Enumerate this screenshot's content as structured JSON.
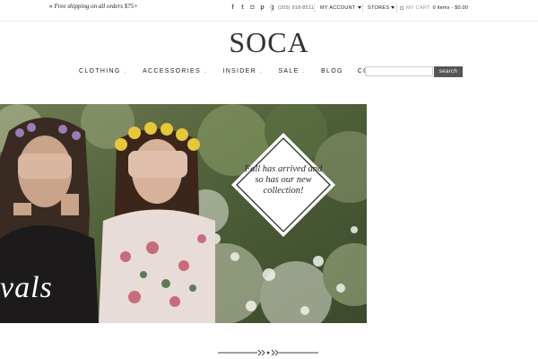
{
  "topbar": {
    "promo_arrows": "»",
    "promo_text": "Free shipping on all orders $75+",
    "social_icons": [
      "facebook-icon",
      "twitter-icon",
      "instagram-icon",
      "pinterest-icon",
      "googleplus-icon"
    ],
    "social_glyphs": [
      "f",
      "t",
      "◘",
      "p",
      "g"
    ],
    "phone": "(205) 918-8511",
    "my_account": "MY ACCOUNT",
    "stores": "STORES",
    "cart_label": "MY CART",
    "cart_summary": "0 items - $0.00"
  },
  "logo": "SOCA",
  "nav": {
    "items": [
      {
        "label": "CLOTHING",
        "dropdown": true
      },
      {
        "label": "ACCESSORIES",
        "dropdown": true
      },
      {
        "label": "INSIDER",
        "dropdown": true
      },
      {
        "label": "SALE",
        "dropdown": true
      },
      {
        "label": "BLOG",
        "dropdown": false
      },
      {
        "label": "CONTACT",
        "dropdown": false
      }
    ],
    "search_placeholder": "",
    "search_button": "search"
  },
  "hero": {
    "badge_text": "Fall has arrived and so has our new collection!",
    "script_text": "vals"
  },
  "colors": {
    "search_button_bg": "#555555",
    "badge_bg": "#ffffff",
    "foliage": "#5b6b3e"
  }
}
